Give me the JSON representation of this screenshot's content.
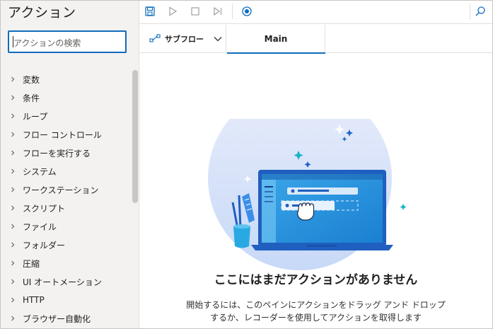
{
  "actions_panel": {
    "title": "アクション",
    "search": {
      "placeholder": "アクションの検索",
      "value": ""
    },
    "groups": [
      {
        "label": "変数"
      },
      {
        "label": "条件"
      },
      {
        "label": "ループ"
      },
      {
        "label": "フロー コントロール"
      },
      {
        "label": "フローを実行する"
      },
      {
        "label": "システム"
      },
      {
        "label": "ワークステーション"
      },
      {
        "label": "スクリプト"
      },
      {
        "label": "ファイル"
      },
      {
        "label": "フォルダー"
      },
      {
        "label": "圧縮"
      },
      {
        "label": "UI オートメーション"
      },
      {
        "label": "HTTP"
      },
      {
        "label": "ブラウザー自動化"
      }
    ]
  },
  "toolbar": {
    "icons": [
      "save-icon",
      "run-icon",
      "stop-icon",
      "step-icon",
      "record-icon",
      "search-icon"
    ]
  },
  "tabs": {
    "subflow_label": "サブフロー",
    "main_label": "Main"
  },
  "canvas": {
    "empty_title": "ここにはまだアクションがありません",
    "empty_desc_line1": "開始するには、このペインにアクションをドラッグ アンド ドロップ",
    "empty_desc_line2": "するか、レコーダーを使用してアクションを取得します"
  },
  "colors": {
    "accent": "#0f6cbd",
    "panel_bg": "#f3f2f1",
    "illustration_blue": "#2f8fd8"
  }
}
